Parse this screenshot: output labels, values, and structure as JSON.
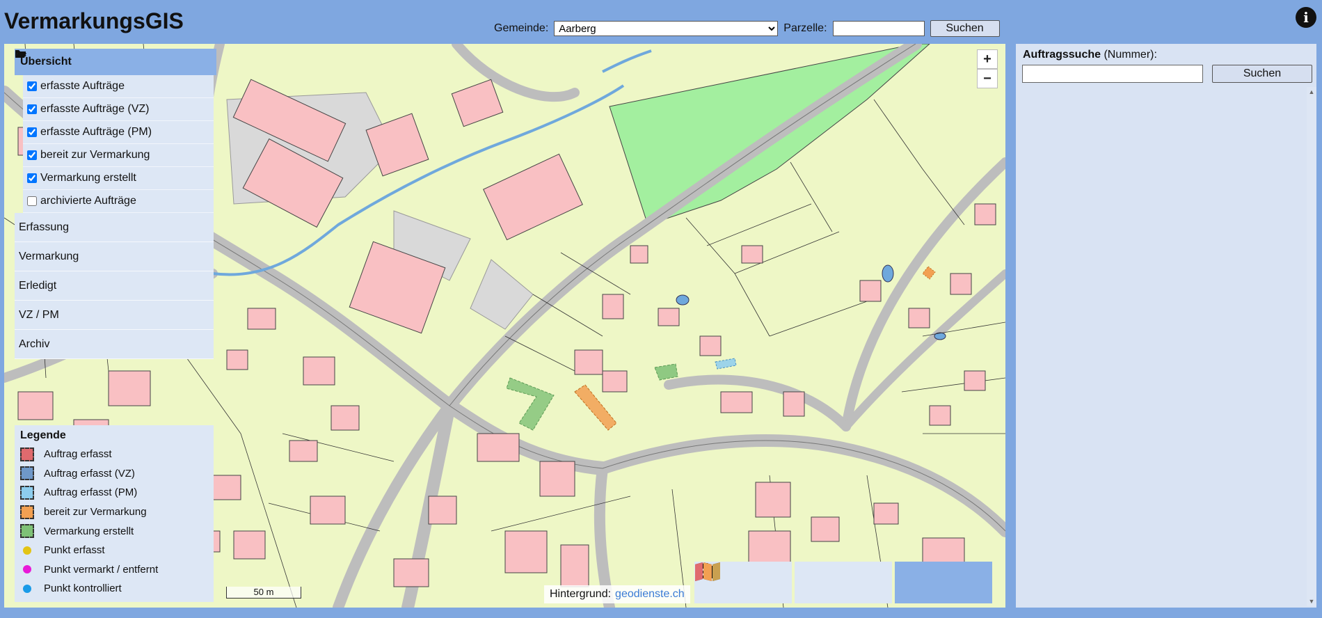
{
  "app": {
    "title": "VermarkungsGIS"
  },
  "search": {
    "gemeinde_label": "Gemeinde:",
    "gemeinde_value": "Aarberg",
    "parzelle_label": "Parzelle:",
    "parzelle_value": "",
    "button": "Suchen"
  },
  "info_icon": "info-icon",
  "map": {
    "zoom_in": "+",
    "zoom_out": "−",
    "scale": "50 m",
    "attribution_label": "Hintergrund:",
    "attribution_link": "geodienste.ch",
    "colors": {
      "parcel_bg": "#eef7c6",
      "building": "#f9c0c3",
      "road": "#bdbdbd",
      "water": "#6fa8dc",
      "green_area": "#a3ef9f",
      "land_use": "#d9d9d9"
    }
  },
  "layers": {
    "header": "Übersicht",
    "items": [
      {
        "label": "erfasste Aufträge",
        "checked": true
      },
      {
        "label": "erfasste Aufträge (VZ)",
        "checked": true
      },
      {
        "label": "erfasste Aufträge (PM)",
        "checked": true
      },
      {
        "label": "bereit zur Vermarkung",
        "checked": true
      },
      {
        "label": "Vermarkung erstellt",
        "checked": true
      },
      {
        "label": "archivierte Aufträge",
        "checked": false
      }
    ],
    "sections": [
      "Erfassung",
      "Vermarkung",
      "Erledigt",
      "VZ / PM",
      "Archiv"
    ]
  },
  "legend": {
    "title": "Legende",
    "items": [
      {
        "label": "Auftrag erfasst",
        "type": "swatch",
        "color": "#e06a6e"
      },
      {
        "label": "Auftrag erfasst (VZ)",
        "type": "swatch",
        "color": "#6f98c9"
      },
      {
        "label": "Auftrag erfasst (PM)",
        "type": "swatch",
        "color": "#8dcdee"
      },
      {
        "label": "bereit zur Vermarkung",
        "type": "swatch",
        "color": "#f2a052"
      },
      {
        "label": "Vermarkung erstellt",
        "type": "swatch",
        "color": "#7ec176"
      },
      {
        "label": "Punkt erfasst",
        "type": "dot",
        "color": "#e3c414"
      },
      {
        "label": "Punkt vermarkt / entfernt",
        "type": "dot",
        "color": "#e81ad8"
      },
      {
        "label": "Punkt kontrolliert",
        "type": "dot",
        "color": "#1a9be8"
      }
    ]
  },
  "basemap_buttons": [
    {
      "icon": "camera-icon",
      "active": false
    },
    {
      "icon": "map-icon",
      "active": false
    },
    {
      "icon": "colored-map-icon",
      "active": true
    }
  ],
  "right_panel": {
    "label_bold": "Auftragssuche",
    "label_rest": " (Nummer):",
    "input_value": "",
    "button": "Suchen"
  }
}
